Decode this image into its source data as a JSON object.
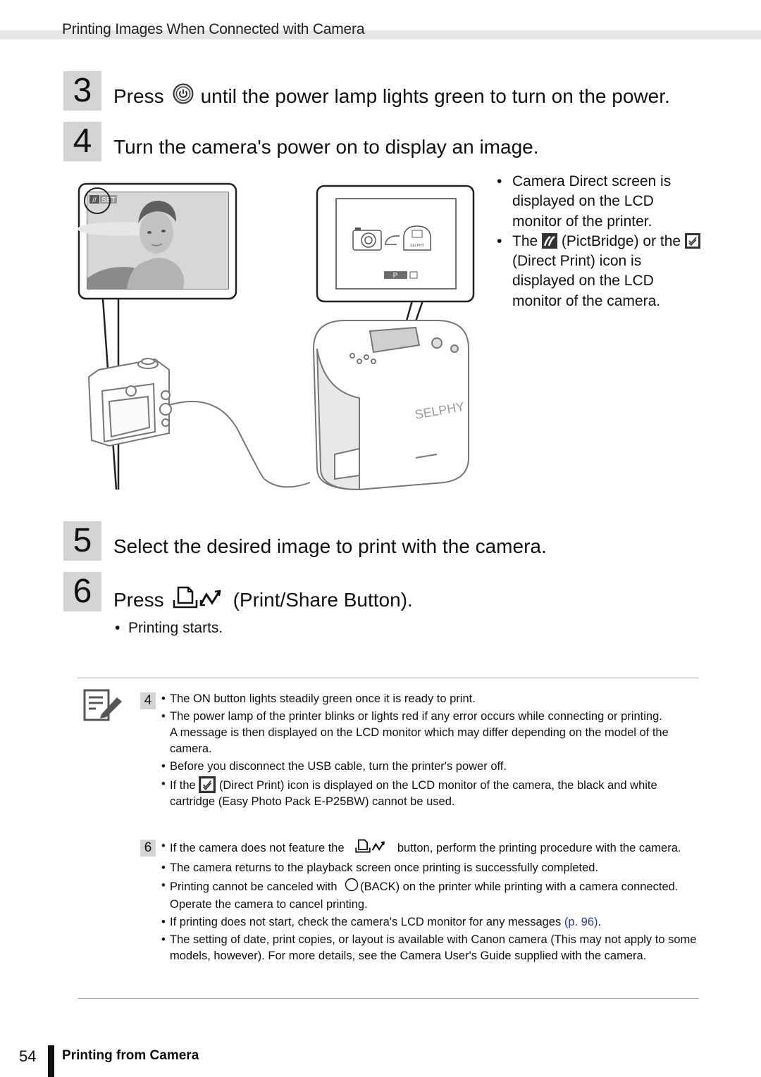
{
  "header": {
    "title": "Printing Images When Connected with Camera"
  },
  "steps": [
    {
      "number": "3",
      "before": "Press",
      "icon": "power-button-icon",
      "after": "until the power lamp lights green to turn on the power."
    },
    {
      "number": "4",
      "text": "Turn the camera's power on to display an image."
    },
    {
      "number": "5",
      "text": "Select the desired image to print with the camera."
    },
    {
      "number": "6",
      "before": "Press",
      "icon": "print-share-icon",
      "after": "(Print/Share Button).",
      "bullets": [
        "Printing starts."
      ]
    }
  ],
  "illustration": {
    "camera_screen_overlay": "SET",
    "printer_screen_badge": "P",
    "printer_brand": "SELPHY",
    "printer_mini_label": "SELPHY"
  },
  "step4_bullets": [
    {
      "text": "Camera Direct screen is displayed on the LCD monitor of the printer."
    },
    {
      "pre": "The",
      "icon": "pictbridge-icon",
      "post": "(PictBridge) or",
      "pre2": "the",
      "icon2": "direct-print-icon",
      "post2": "(Direct Print) icon is displayed on the LCD monitor of the camera."
    }
  ],
  "notes": {
    "groups": [
      {
        "step": "4",
        "items": [
          {
            "text": "The ON button lights steadily green once it is ready to print."
          },
          {
            "text": "The power lamp of the printer blinks or lights red if any error occurs while connecting or printing.",
            "extra": "A message is then displayed on the LCD monitor which may differ depending on the model of the camera."
          },
          {
            "text": "Before you disconnect the USB cable, turn the printer's power off."
          },
          {
            "pre": "If the",
            "icon": "direct-print-icon",
            "post": "(Direct Print) icon is displayed on the LCD monitor of the camera, the black and white cartridge (Easy Photo Pack E-P25BW) cannot be used."
          }
        ]
      },
      {
        "step": "6",
        "items": [
          {
            "pre": "If the camera does not feature the",
            "icon": "print-share-icon",
            "post": "button, perform the printing procedure with the camera."
          },
          {
            "text": "The camera returns to the playback screen once printing is successfully completed."
          },
          {
            "pre": "Printing cannot be canceled with",
            "icon": "back-button-icon",
            "post": "(BACK)  on the printer while printing with a camera connected. Operate the camera to cancel printing."
          },
          {
            "pre": "If printing does not start, check the camera's LCD monitor for any messages",
            "link": "(p. 96)",
            "post": "."
          },
          {
            "text": "The setting of date, print copies, or layout is available with Canon camera (This may not apply to some models, however). For more details, see the Camera User's Guide supplied with the camera."
          }
        ]
      }
    ]
  },
  "footer": {
    "page_number": "54",
    "section_title": "Printing from Camera"
  },
  "colors": {
    "link": "#2233cc",
    "step_box": "#d4d4d4",
    "header_bar": "#e6e6e6"
  }
}
